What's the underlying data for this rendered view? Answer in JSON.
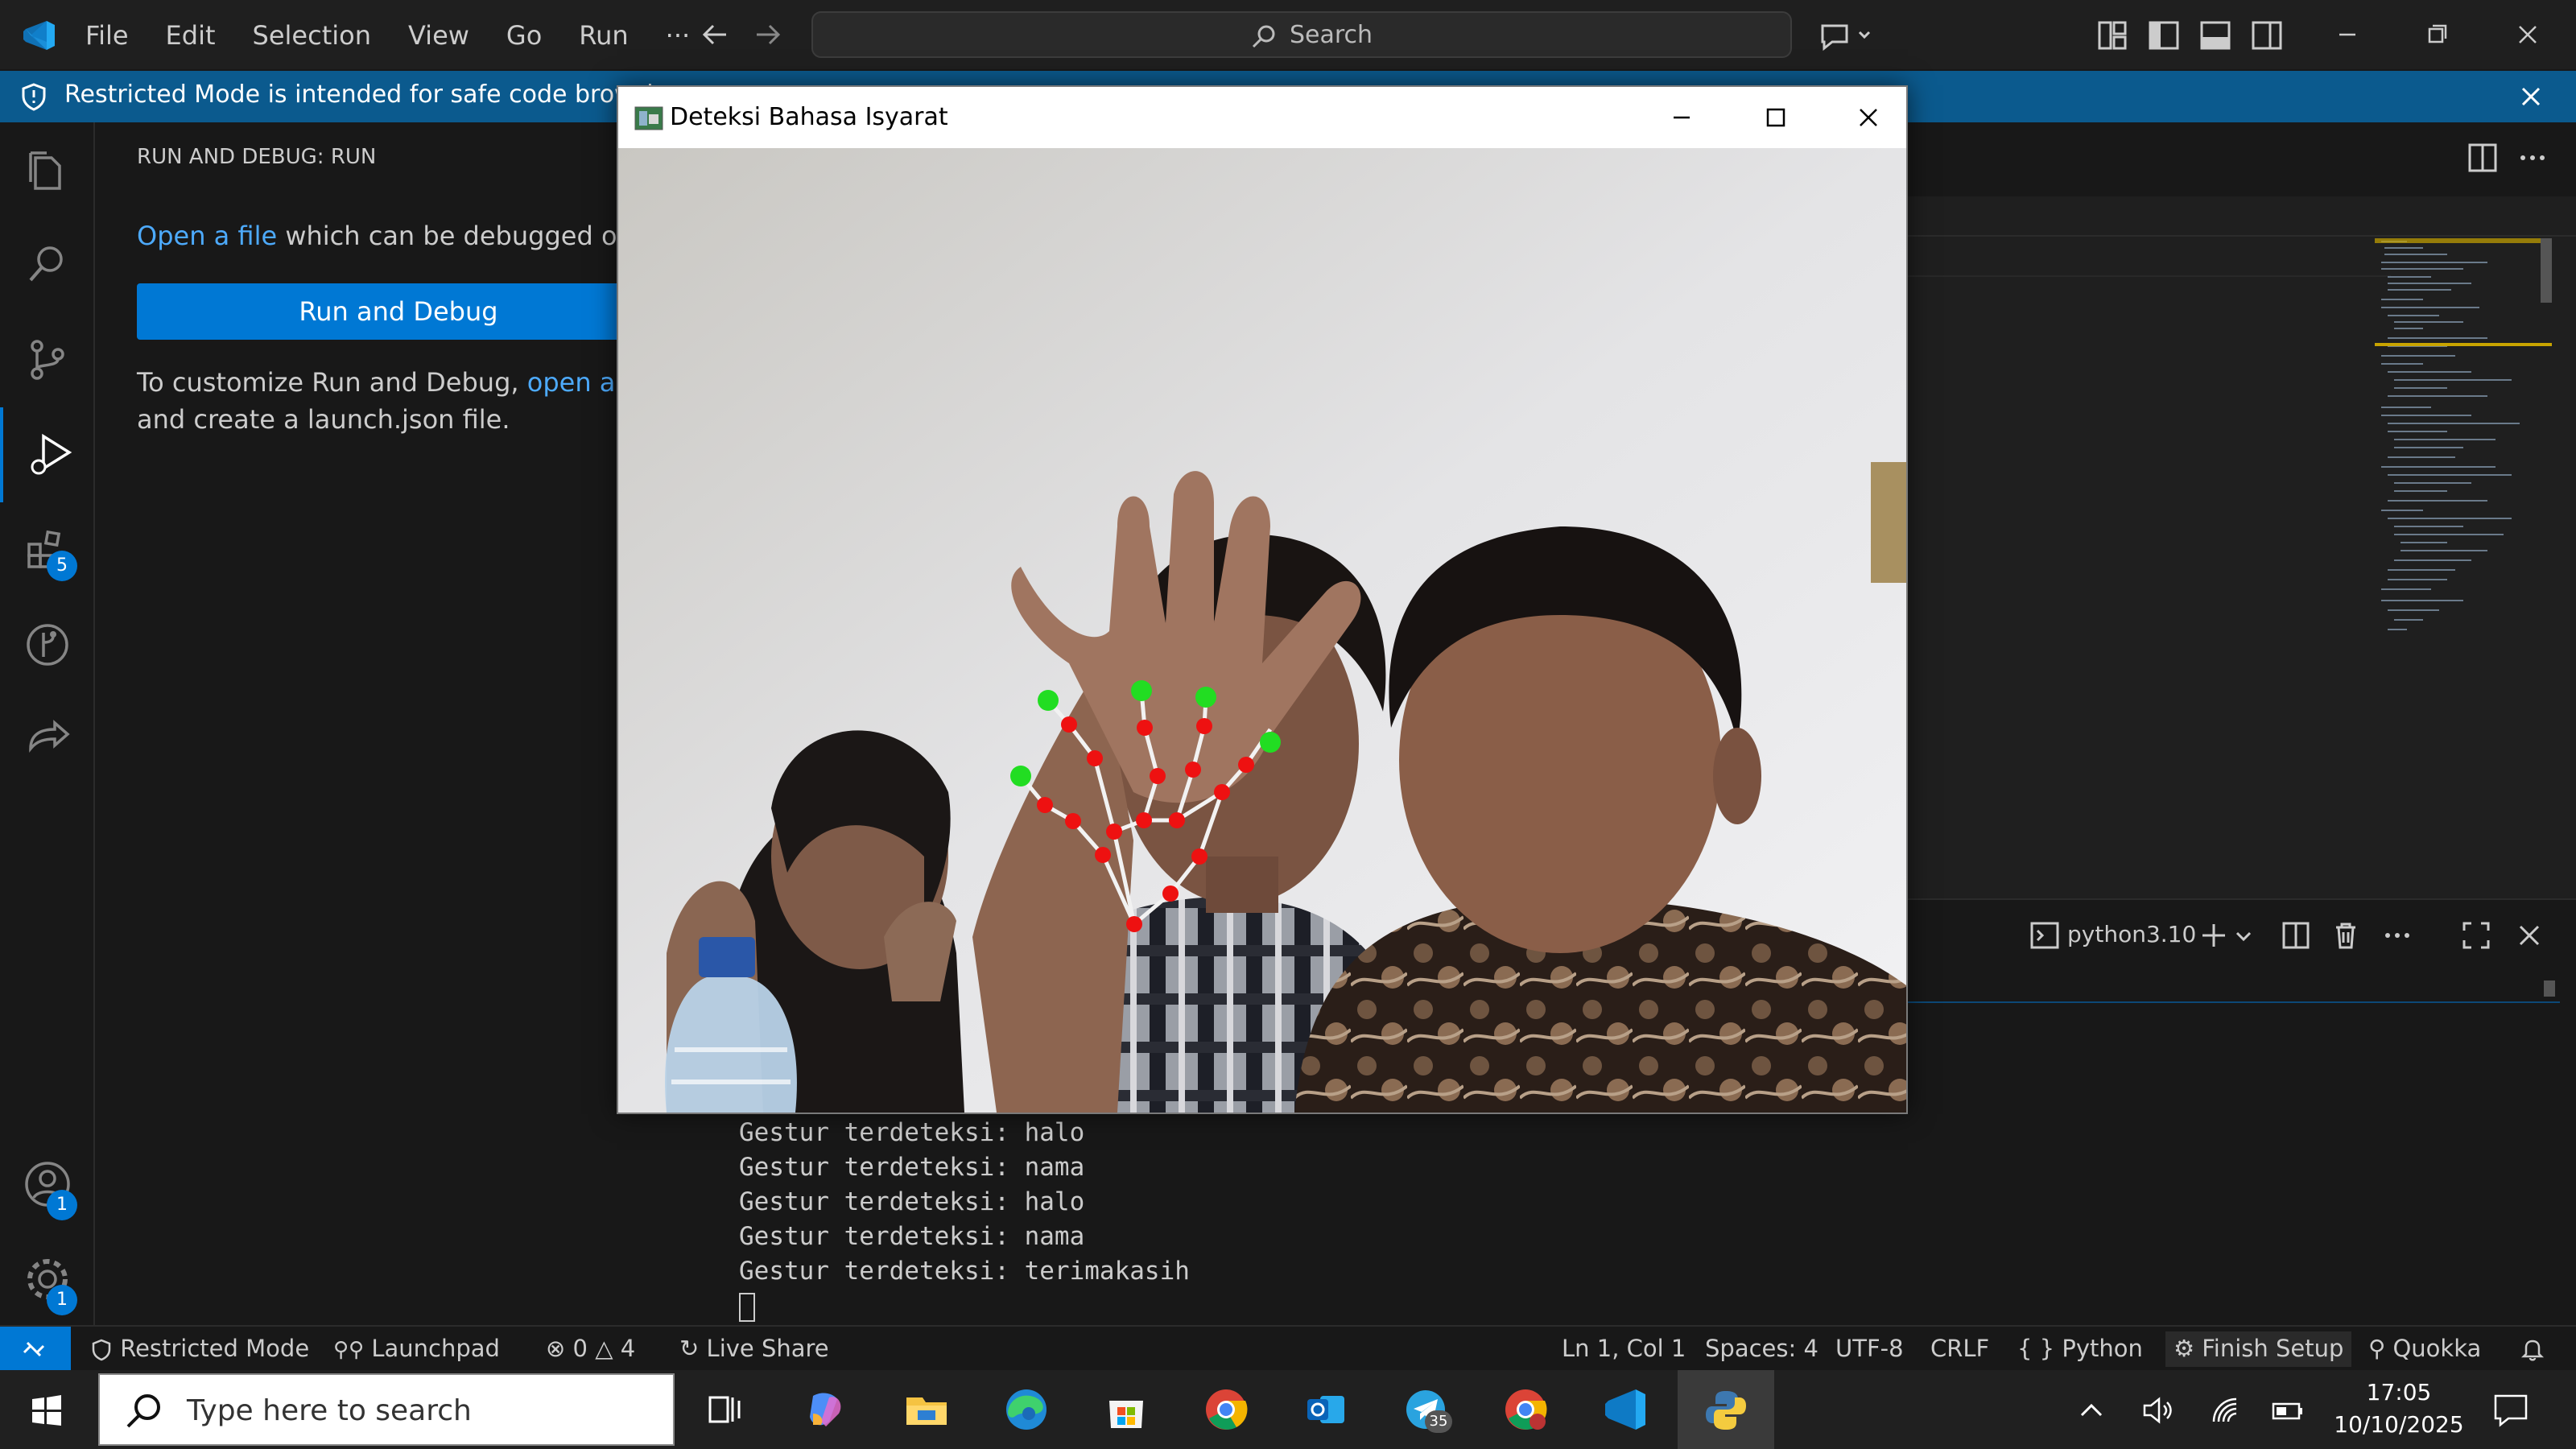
{
  "menu": [
    "File",
    "Edit",
    "Selection",
    "View",
    "Go",
    "Run",
    "···"
  ],
  "search": {
    "label": "Search"
  },
  "banner": {
    "text": "Restricted Mode is intended for safe code browsing."
  },
  "activity_badges": {
    "extensions": "5",
    "accounts": "1",
    "manage": "1"
  },
  "sidebar": {
    "header": "RUN AND DEBUG: RUN",
    "open_file_link": "Open a file",
    "open_file_rest": " which can be debugged or run",
    "run_button": "Run and Debug",
    "customize_prefix": "To customize Run and Debug, ",
    "open_folder_link": "open a folder",
    "customize_line2": "and create a launch.json file."
  },
  "camera_window": {
    "title": "Deteksi Bahasa Isyarat"
  },
  "terminal": {
    "shell_label": "python3.10",
    "lines": [
      "Gestur terdeteksi: halo",
      "Gestur terdeteksi: nama",
      "Gestur terdeteksi: halo",
      "Gestur terdeteksi: nama",
      "Gestur terdeteksi: terimakasih"
    ]
  },
  "statusbar": {
    "restricted": "Restricted Mode",
    "launchpad": "Launchpad",
    "errors": "0",
    "warnings": "4",
    "live_share": "Live Share",
    "position": "Ln 1, Col 1",
    "spaces": "Spaces: 4",
    "encoding": "UTF-8",
    "eol": "CRLF",
    "language": "Python",
    "finish_setup": "Finish Setup",
    "quokka": "Quokka"
  },
  "taskbar": {
    "search_placeholder": "Type here to search",
    "telegram_badge": "35",
    "time": "17:05",
    "date": "10/10/2025"
  },
  "colors": {
    "accent": "#0078d4",
    "banner": "#0b5a8e",
    "landmark_tip": "#22dd22",
    "landmark_joint": "#ee1111"
  },
  "icons": [
    "vscode-logo-icon",
    "back-icon",
    "forward-icon",
    "search-icon",
    "copilot-icon",
    "layout-icon",
    "minimize-icon",
    "restore-icon",
    "close-icon",
    "shield-icon",
    "explorer-icon",
    "scm-icon",
    "run-debug-icon",
    "extensions-icon",
    "git-graph-icon",
    "live-share-icon",
    "accounts-icon",
    "manage-gear-icon",
    "terminal-icon",
    "add-icon",
    "split-icon",
    "trash-icon",
    "maximize-icon",
    "windows-start-icon",
    "task-view-icon",
    "copilot-app-icon",
    "file-explorer-icon",
    "edge-icon",
    "store-icon",
    "chrome-icon",
    "outlook-icon",
    "telegram-icon",
    "python-icon",
    "notification-icon"
  ]
}
